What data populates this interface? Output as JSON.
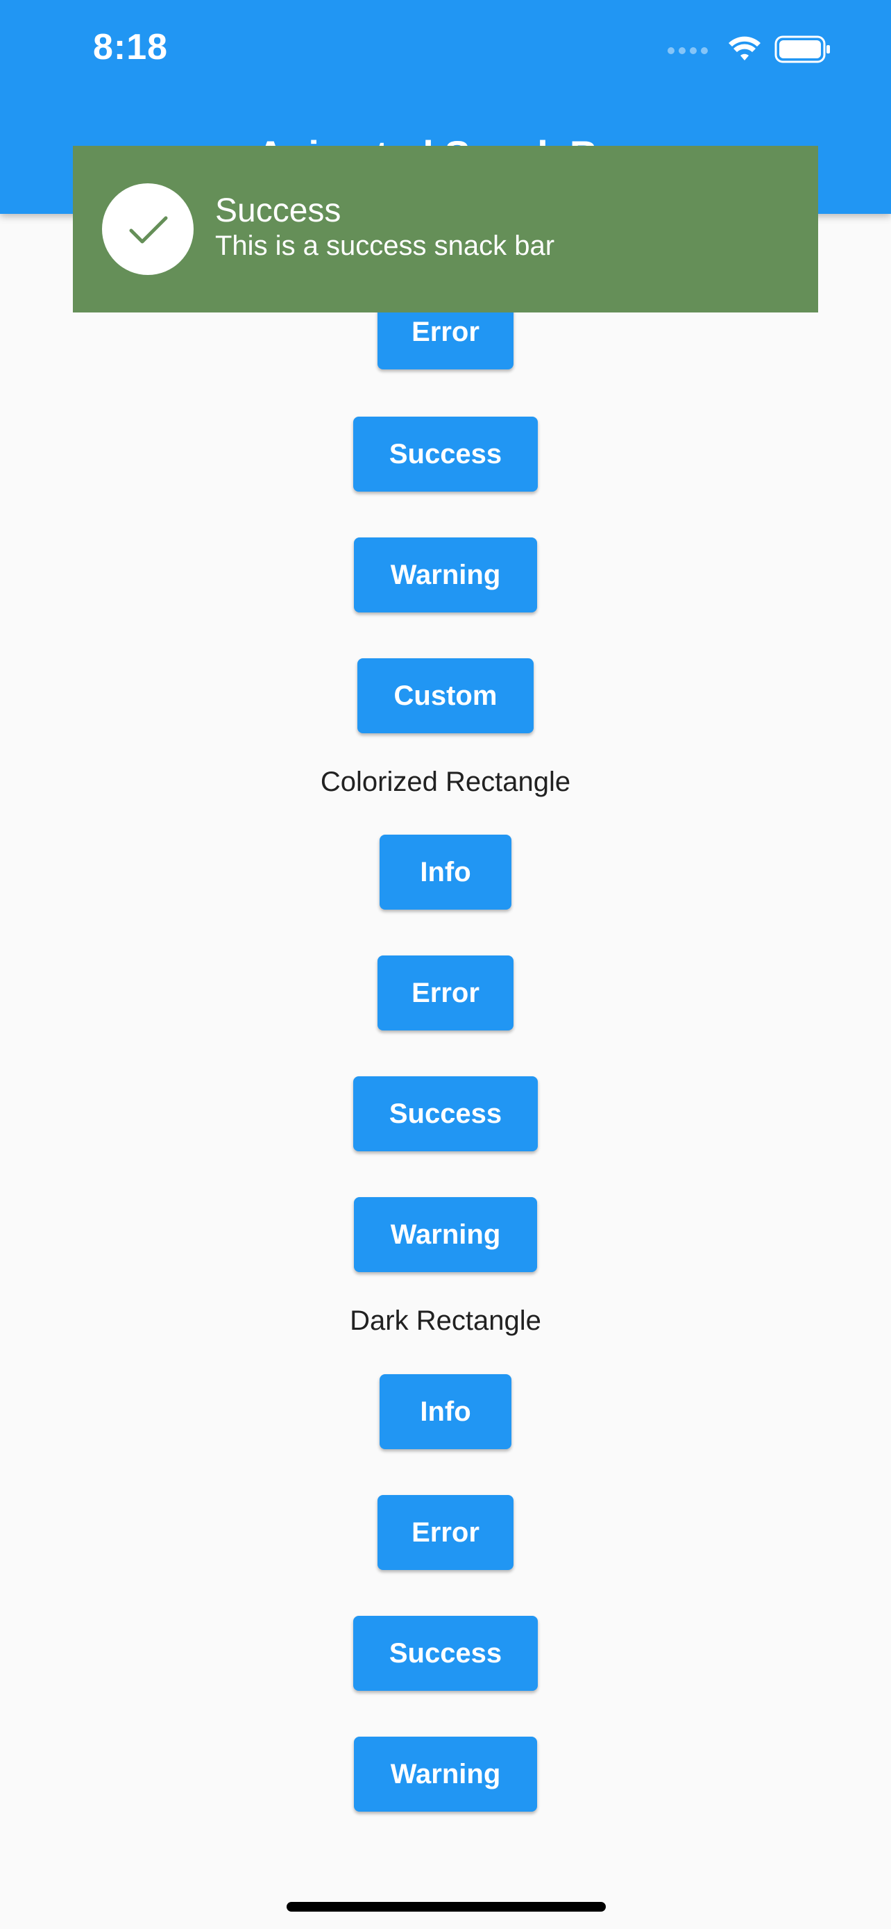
{
  "status_bar": {
    "time": "8:18"
  },
  "app_bar": {
    "title": "Animated Snack Bar"
  },
  "snackbar": {
    "icon": "check-icon",
    "title": "Success",
    "message": "This is a success snack bar",
    "background_color": "#658f58"
  },
  "colors": {
    "primary": "#2196f3",
    "background": "#fafafa"
  },
  "sections": [
    {
      "label": "",
      "buttons": [
        "Error",
        "Success",
        "Warning",
        "Custom"
      ]
    },
    {
      "label": "Colorized Rectangle",
      "buttons": [
        "Info",
        "Error",
        "Success",
        "Warning"
      ]
    },
    {
      "label": "Dark Rectangle",
      "buttons": [
        "Info",
        "Error",
        "Success",
        "Warning"
      ]
    }
  ]
}
